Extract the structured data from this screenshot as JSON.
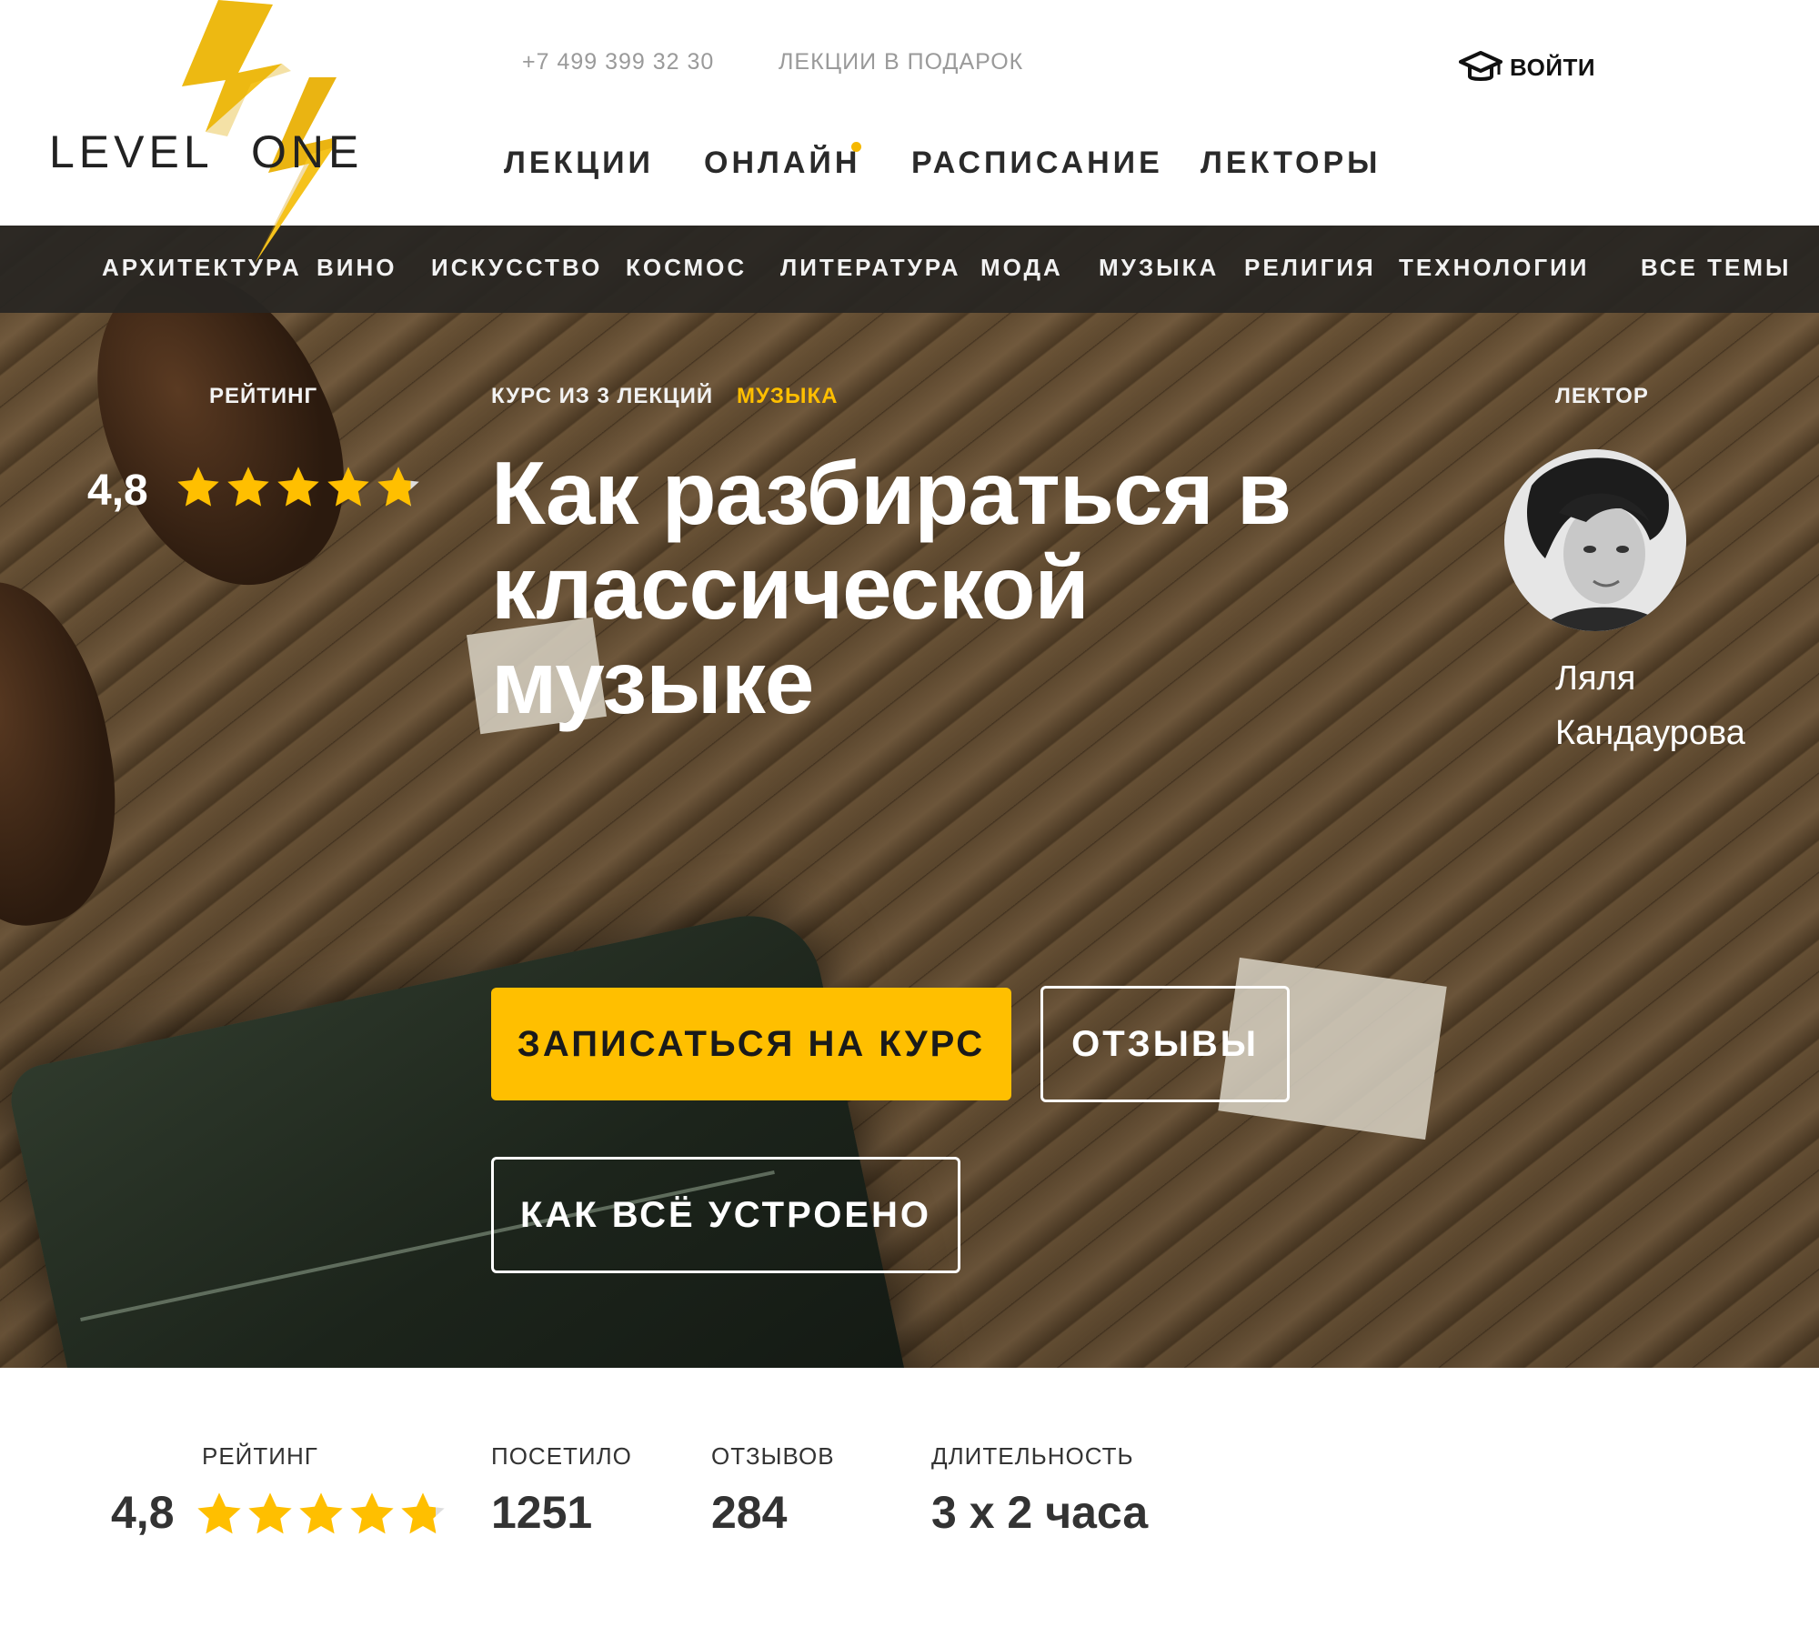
{
  "header": {
    "logo": {
      "left": "LEVEL",
      "right": "ONE"
    },
    "phone": "+7 499 399 32 30",
    "gift_link": "ЛЕКЦИИ В ПОДАРОК",
    "login_label": "ВОЙТИ",
    "nav": [
      "ЛЕКЦИИ",
      "ОНЛАЙН",
      "РАСПИСАНИЕ",
      "ЛЕКТОРЫ"
    ]
  },
  "categories": [
    "АРХИТЕКТУРА",
    "ВИНО",
    "ИСКУССТВО",
    "КОСМОС",
    "ЛИТЕРАТУРА",
    "МОДА",
    "МУЗЫКА",
    "РЕЛИГИЯ",
    "ТЕХНОЛОГИИ",
    "ВСЕ ТЕМЫ"
  ],
  "hero": {
    "rating_label": "РЕЙТИНГ",
    "rating_value": "4,8",
    "rating_stars": 4.8,
    "course_info": "КУРС ИЗ 3 ЛЕКЦИЙ",
    "category": "МУЗЫКА",
    "title": "Как разбираться в классической музыке",
    "lecturer_label": "ЛЕКТОР",
    "lecturer_first": "Ляля",
    "lecturer_last": "Кандаурова",
    "buttons": {
      "enroll": "ЗАПИСАТЬСЯ НА КУРС",
      "reviews": "ОТЗЫВЫ",
      "how_it_works": "КАК ВСЁ УСТРОЕНО"
    }
  },
  "stats": {
    "rating_label": "РЕЙТИНГ",
    "rating_value": "4,8",
    "rating_stars": 4.8,
    "visited_label": "ПОСЕТИЛО",
    "visited_value": "1251",
    "reviews_label": "ОТЗЫВОВ",
    "reviews_value": "284",
    "duration_label": "ДЛИТЕЛЬНОСТЬ",
    "duration_value": "3 х 2 часа"
  },
  "colors": {
    "accent": "#ffbf00",
    "catbar": "#2b2925",
    "star": "#ffbf00"
  },
  "icons": {
    "logo": "lightning-bolt-icon",
    "login": "graduation-cap-icon",
    "rating": "star-icon"
  }
}
